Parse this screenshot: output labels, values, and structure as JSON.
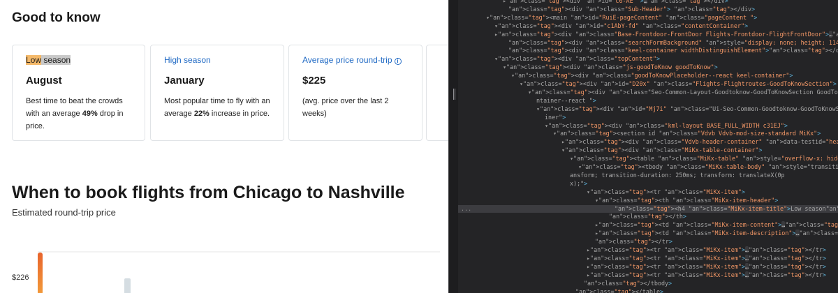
{
  "good_to_know": {
    "heading": "Good to know",
    "cards": {
      "low": {
        "label_part1": "Low",
        "label_part2": " season",
        "value": "August",
        "desc_1": "Best time to beat the crowds with an average ",
        "desc_bold": "49%",
        "desc_2": " drop in price."
      },
      "high": {
        "label": "High season",
        "value": "January",
        "desc_1": "Most popular time to fly with an average ",
        "desc_bold": "22%",
        "desc_2": " increase in price."
      },
      "avg": {
        "label": "Average price round-trip",
        "info_icon": "ⓘ",
        "value": "$225",
        "desc": "(avg. price over the last 2 weeks)"
      }
    }
  },
  "book": {
    "heading": "When to book flights from Chicago to Nashville",
    "subtitle": "Estimated round-trip price",
    "y_tick": "$226"
  },
  "colors": {
    "accent_link": "#1f69c4",
    "bar_orange": "#e8642c",
    "bar_grey": "#d5dde2",
    "devtools_bg": "#242426"
  },
  "devtools": {
    "lines": [
      {
        "t": "<div id=\"c6-AE\" >…</div>"
      },
      {
        "t": "<div class=\"Sub-Header\"> </div>"
      },
      {
        "t": "<main id=\"RuiE-pageContent\" class=\"pageContent \">"
      },
      {
        "t": "<div id=\"c1AbY-fd\" class=\"contentContainer\">"
      },
      {
        "t": "<div class=\"Base-Frontdoor-FrontDoor Flights-Frontdoor-FlightFrontDoor\">…</div>"
      },
      {
        "t": "<div class=\"searchFormBackground\" style=\"display: none; height: 114px;\"></div>"
      },
      {
        "t": "<div class=\"keel-container widthDistinguishElement\"></div>"
      },
      {
        "t": "<div class=\"topContent\">"
      },
      {
        "t": "<div class=\"js-goodToKnow goodToKnow\">"
      },
      {
        "t": "<div class=\"goodToKnowPlaceholder--react keel-container\">"
      },
      {
        "t": "<div id=\"D20x\" class=\"Flights-Flightroutes-GoodToKnowSection\">"
      },
      {
        "t": "<div class=\"Seo-Common-Layout-Goodtoknow-GoodToKnowSection GoodToKnowCo"
      },
      {
        "t": "ntainer--react \">"
      },
      {
        "t": "<div id=\"Mj7i\" class=\"Ui-Seo-Common-Goodtoknow-GoodToKnowSection-conta"
      },
      {
        "t": "iner\">"
      },
      {
        "t": "<div class=\"kml-layout BASE_FULL_WIDTH c31EJ\">"
      },
      {
        "t": "<section id class=\"Vdvb Vdvb-mod-size-standard MiKx\">"
      },
      {
        "t": "<div class=\"Vdvb-header-container\" data-testid=\"header\">…</div>"
      },
      {
        "t": "<div class=\"MiKx-table-container\">"
      },
      {
        "t": "<table class=\"MiKx-table\" style=\"overflow-x: hidden;\">"
      },
      {
        "t": "<tbody class=\"MiKx-table-body\" style=\"transition-property: tr"
      },
      {
        "t": "ansform; transition-duration: 250ms; transform: translateX(0p"
      },
      {
        "t": "x);\">"
      },
      {
        "t": "<tr class=\"MiKx-item\">"
      },
      {
        "t": "<th class=\"MiKx-item-header\">"
      },
      {
        "t": "<h4 class=\"MiKx-item-title\">Low season</h4> == $0"
      },
      {
        "t": "</th>"
      },
      {
        "t": "<td class=\"MiKx-item-content\">…</td>"
      },
      {
        "t": "<td class=\"MiKx-item-description\">…</td>"
      },
      {
        "t": "</tr>"
      },
      {
        "t": "<tr class=\"MiKx-item\">…</tr>"
      },
      {
        "t": "<tr class=\"MiKx-item\">…</tr>"
      },
      {
        "t": "<tr class=\"MiKx-item\">…</tr>"
      },
      {
        "t": "<tr class=\"MiKx-item\">…</tr>"
      },
      {
        "t": "</tbody>"
      },
      {
        "t": "</table>"
      }
    ],
    "selected_dots": "..."
  }
}
